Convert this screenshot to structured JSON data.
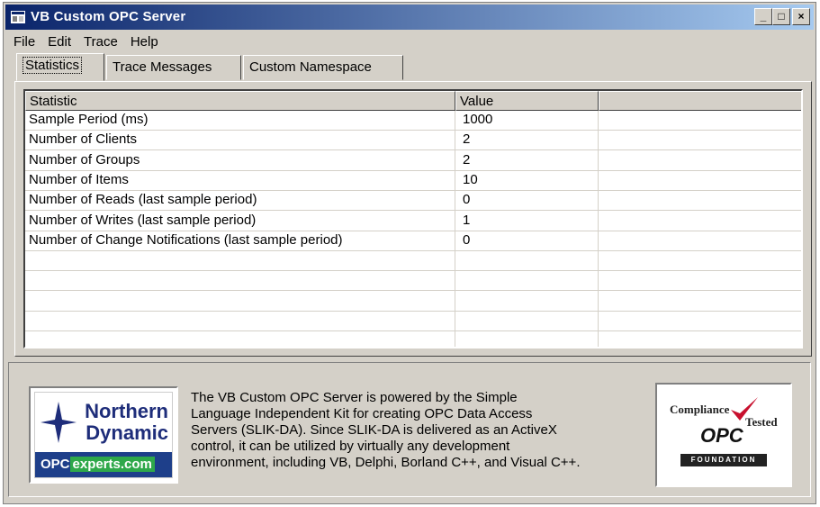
{
  "window": {
    "title": "VB Custom OPC Server",
    "controls": {
      "minimize": "_",
      "maximize": "□",
      "close": "×"
    }
  },
  "menu": [
    "File",
    "Edit",
    "Trace",
    "Help"
  ],
  "tabs": [
    {
      "label": "Statistics",
      "active": true
    },
    {
      "label": "Trace Messages",
      "active": false
    },
    {
      "label": "Custom Namespace",
      "active": false
    }
  ],
  "grid": {
    "columns": [
      "Statistic",
      "Value",
      ""
    ],
    "rows": [
      {
        "statistic": "Sample Period (ms)",
        "value": "1000"
      },
      {
        "statistic": "Number of Clients",
        "value": "2"
      },
      {
        "statistic": "Number of Groups",
        "value": "2"
      },
      {
        "statistic": "Number of Items",
        "value": "10"
      },
      {
        "statistic": "Number of Reads (last sample period)",
        "value": "0"
      },
      {
        "statistic": "Number of Writes (last sample period)",
        "value": "1"
      },
      {
        "statistic": "Number of Change Notifications (last sample period)",
        "value": "0"
      },
      {
        "statistic": "",
        "value": ""
      },
      {
        "statistic": "",
        "value": ""
      },
      {
        "statistic": "",
        "value": ""
      },
      {
        "statistic": "",
        "value": ""
      }
    ]
  },
  "info": {
    "description_lines": [
      "The VB Custom OPC Server is powered by the Simple",
      "Language Independent Kit for creating OPC Data Access",
      "Servers (SLIK-DA).  Since SLIK-DA is delivered as an ActiveX",
      "control, it can be utilized by virtually any development",
      "environment, including VB, Delphi, Borland C++, and Visual C++."
    ],
    "logo_left": {
      "line1": "Northern",
      "line2": "Dynamic",
      "site_a": "OPC",
      "site_b": "experts.com"
    },
    "logo_right": {
      "compliance": "Compliance",
      "tested": "Tested",
      "opc": "OPC",
      "foundation": "FOUNDATION"
    }
  },
  "colors": {
    "titlebar_start": "#0a246a",
    "titlebar_end": "#a6caf0",
    "face": "#d4d0c8",
    "brand_blue": "#1e2d7a",
    "brand_green": "#2ea84a"
  }
}
